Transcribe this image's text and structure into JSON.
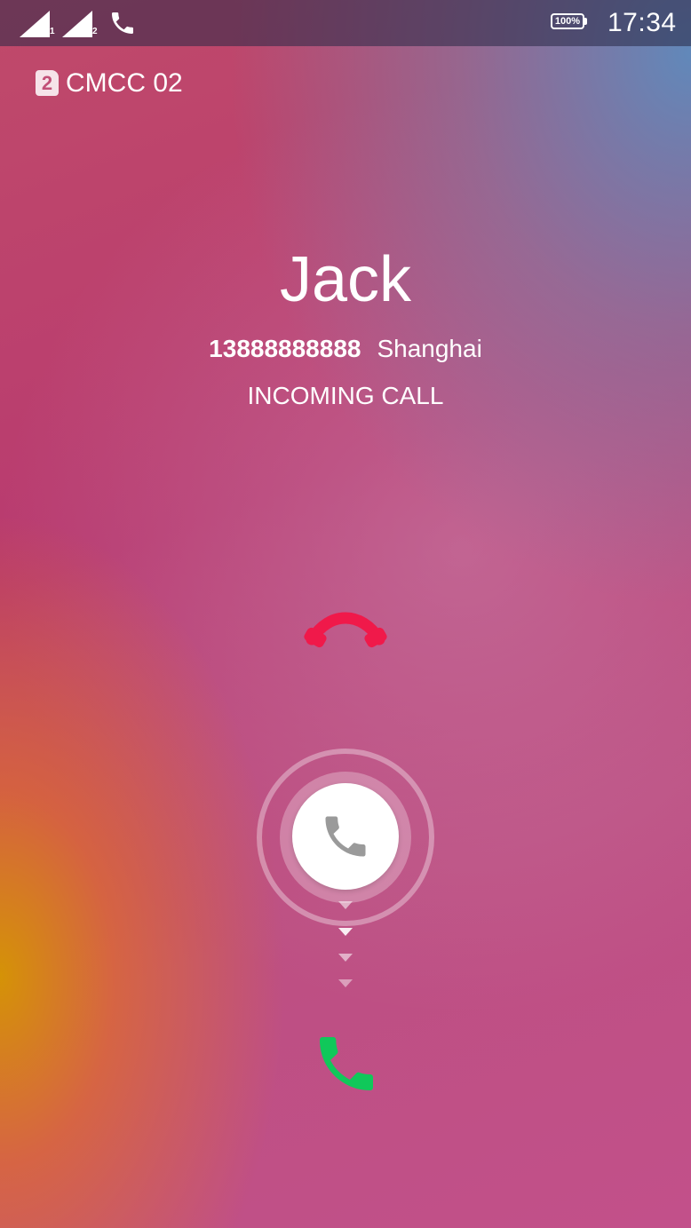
{
  "status_bar": {
    "sim1_sub": "1",
    "sim2_sub": "2",
    "battery": "100%",
    "time": "17:34",
    "icons": [
      "signal-sim1-icon",
      "signal-sim2-icon",
      "call-active-icon",
      "battery-icon"
    ]
  },
  "sim": {
    "slot": "2",
    "carrier": "CMCC 02"
  },
  "caller": {
    "name": "Jack",
    "number": "13888888888",
    "location": "Shanghai",
    "status": "INCOMING CALL"
  },
  "controls": {
    "decline_icon": "hang-up-icon",
    "knob_icon": "phone-icon",
    "accept_icon": "answer-icon"
  },
  "colors": {
    "decline": "#f0194a",
    "accept": "#10c85a",
    "knob_icon": "#9a9a9a"
  }
}
